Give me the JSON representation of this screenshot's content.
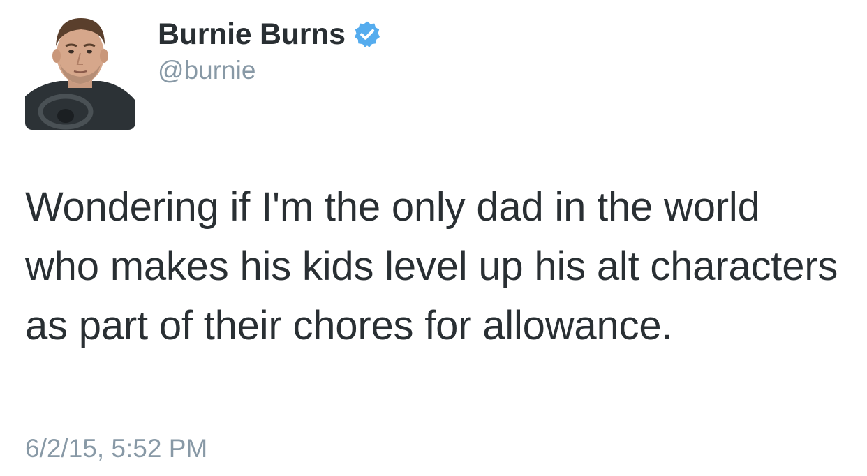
{
  "author": {
    "display_name": "Burnie Burns",
    "handle": "@burnie",
    "verified": true,
    "avatar_icon": "user-avatar-photo"
  },
  "tweet": {
    "text": "Wondering if I'm the only dad in the world who makes his kids level up his alt characters as part of their chores for allowance.",
    "timestamp": "6/2/15, 5:52 PM"
  },
  "colors": {
    "name": "#292f33",
    "text": "#292f33",
    "muted": "#8899a6",
    "verified_badge": "#55acee",
    "background": "#ffffff"
  }
}
